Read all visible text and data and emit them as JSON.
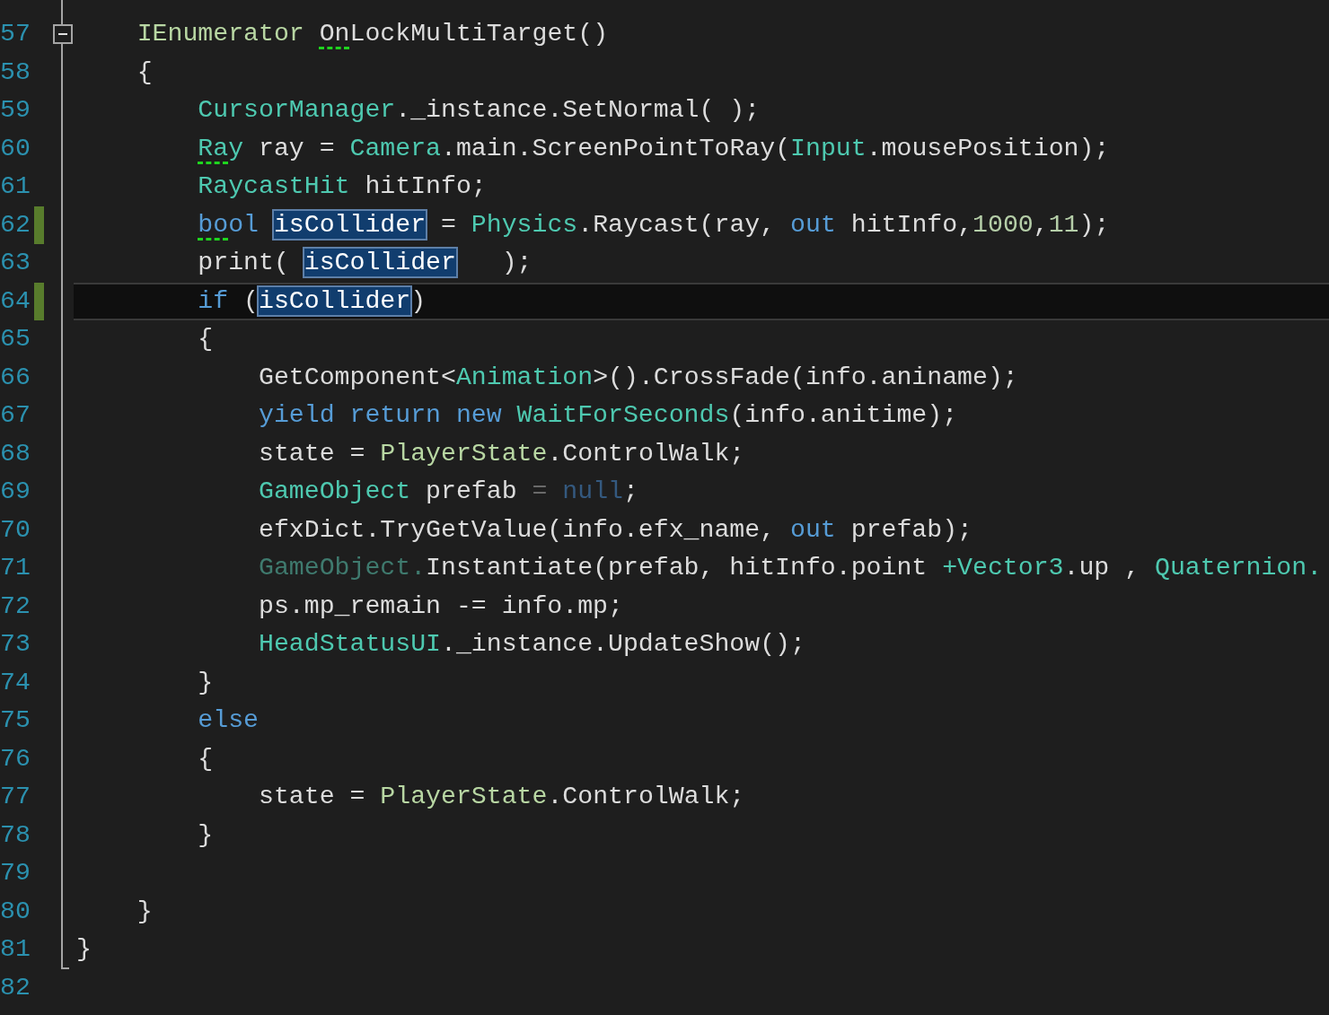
{
  "lines": [
    {
      "number": "57",
      "changed": false,
      "current": false,
      "fold_start": true,
      "fold_end": false,
      "tokens": [
        {
          "text": "    IEnumerator ",
          "kind": "interface"
        },
        {
          "text": "On",
          "kind": "plain",
          "squiggle": true
        },
        {
          "text": "LockMultiTarget()",
          "kind": "plain"
        }
      ]
    },
    {
      "number": "58",
      "changed": false,
      "current": false,
      "fold_start": false,
      "fold_end": false,
      "tokens": [
        {
          "text": "    {",
          "kind": "plain"
        }
      ]
    },
    {
      "number": "59",
      "changed": false,
      "current": false,
      "fold_start": false,
      "fold_end": false,
      "tokens": [
        {
          "text": "        CursorManager",
          "kind": "type"
        },
        {
          "text": "._instance.SetNormal( );",
          "kind": "plain"
        }
      ]
    },
    {
      "number": "60",
      "changed": false,
      "current": false,
      "fold_start": false,
      "fold_end": false,
      "tokens": [
        {
          "text": "        Ra",
          "kind": "type",
          "squiggle": true
        },
        {
          "text": "y",
          "kind": "type"
        },
        {
          "text": " ray = ",
          "kind": "plain"
        },
        {
          "text": "Camera",
          "kind": "type"
        },
        {
          "text": ".main.ScreenPointToRay(",
          "kind": "plain"
        },
        {
          "text": "Input",
          "kind": "type"
        },
        {
          "text": ".mousePosition);",
          "kind": "plain"
        }
      ]
    },
    {
      "number": "61",
      "changed": false,
      "current": false,
      "fold_start": false,
      "fold_end": false,
      "tokens": [
        {
          "text": "        RaycastHit",
          "kind": "type"
        },
        {
          "text": " hitInfo;",
          "kind": "plain"
        }
      ]
    },
    {
      "number": "62",
      "changed": true,
      "current": false,
      "fold_start": false,
      "fold_end": false,
      "tokens": [
        {
          "text": "        bo",
          "kind": "keyword",
          "squiggle": true
        },
        {
          "text": "ol ",
          "kind": "keyword"
        },
        {
          "text": "isCollider",
          "kind": "match"
        },
        {
          "text": " = ",
          "kind": "plain"
        },
        {
          "text": "Physics",
          "kind": "type"
        },
        {
          "text": ".Raycast(ray, ",
          "kind": "plain"
        },
        {
          "text": "out",
          "kind": "keyword"
        },
        {
          "text": " hitInfo,",
          "kind": "plain"
        },
        {
          "text": "1000",
          "kind": "number"
        },
        {
          "text": ",",
          "kind": "plain"
        },
        {
          "text": "11",
          "kind": "number"
        },
        {
          "text": ");",
          "kind": "plain"
        }
      ]
    },
    {
      "number": "63",
      "changed": false,
      "current": false,
      "fold_start": false,
      "fold_end": false,
      "tokens": [
        {
          "text": "        print( ",
          "kind": "plain"
        },
        {
          "text": "isCollider",
          "kind": "match"
        },
        {
          "text": "   );",
          "kind": "plain"
        }
      ]
    },
    {
      "number": "64",
      "changed": true,
      "current": true,
      "fold_start": false,
      "fold_end": false,
      "tokens": [
        {
          "text": "        if",
          "kind": "keyword"
        },
        {
          "text": " (",
          "kind": "plain"
        },
        {
          "text": "isCollider",
          "kind": "match"
        },
        {
          "text": ")",
          "kind": "plain"
        }
      ]
    },
    {
      "number": "65",
      "changed": false,
      "current": false,
      "fold_start": false,
      "fold_end": false,
      "tokens": [
        {
          "text": "        {",
          "kind": "plain"
        }
      ]
    },
    {
      "number": "66",
      "changed": false,
      "current": false,
      "fold_start": false,
      "fold_end": false,
      "tokens": [
        {
          "text": "            GetComponent<",
          "kind": "plain"
        },
        {
          "text": "Animation",
          "kind": "type"
        },
        {
          "text": ">().CrossFade(info.aniname);",
          "kind": "plain"
        }
      ]
    },
    {
      "number": "67",
      "changed": false,
      "current": false,
      "fold_start": false,
      "fold_end": false,
      "tokens": [
        {
          "text": "            yield return new ",
          "kind": "keyword"
        },
        {
          "text": "WaitForSeconds",
          "kind": "type"
        },
        {
          "text": "(info.anitime);",
          "kind": "plain"
        }
      ]
    },
    {
      "number": "68",
      "changed": false,
      "current": false,
      "fold_start": false,
      "fold_end": false,
      "tokens": [
        {
          "text": "            state = ",
          "kind": "plain"
        },
        {
          "text": "PlayerState",
          "kind": "interface"
        },
        {
          "text": ".ControlWalk;",
          "kind": "plain"
        }
      ]
    },
    {
      "number": "69",
      "changed": false,
      "current": false,
      "fold_start": false,
      "fold_end": false,
      "tokens": [
        {
          "text": "            GameObject",
          "kind": "type"
        },
        {
          "text": " prefab ",
          "kind": "plain"
        },
        {
          "text": "= ",
          "kind": "dim-operator"
        },
        {
          "text": "null",
          "kind": "dim-keyword"
        },
        {
          "text": ";",
          "kind": "plain"
        }
      ]
    },
    {
      "number": "70",
      "changed": false,
      "current": false,
      "fold_start": false,
      "fold_end": false,
      "tokens": [
        {
          "text": "            efxDict.TryGetValue(info.efx_name, ",
          "kind": "plain"
        },
        {
          "text": "out",
          "kind": "keyword"
        },
        {
          "text": " prefab);",
          "kind": "plain"
        }
      ]
    },
    {
      "number": "71",
      "changed": false,
      "current": false,
      "fold_start": false,
      "fold_end": false,
      "tokens": [
        {
          "text": "            GameObject.",
          "kind": "dim-type"
        },
        {
          "text": "Instantiate(prefab, hitInfo.point ",
          "kind": "plain"
        },
        {
          "text": "+Vector3",
          "kind": "type"
        },
        {
          "text": ".up , ",
          "kind": "plain"
        },
        {
          "text": "Quaternion.",
          "kind": "type"
        }
      ]
    },
    {
      "number": "72",
      "changed": false,
      "current": false,
      "fold_start": false,
      "fold_end": false,
      "tokens": [
        {
          "text": "            ps.mp_remain -= info.mp;",
          "kind": "plain"
        }
      ]
    },
    {
      "number": "73",
      "changed": false,
      "current": false,
      "fold_start": false,
      "fold_end": false,
      "tokens": [
        {
          "text": "            HeadStatusUI",
          "kind": "type"
        },
        {
          "text": "._instance.UpdateShow();",
          "kind": "plain"
        }
      ]
    },
    {
      "number": "74",
      "changed": false,
      "current": false,
      "fold_start": false,
      "fold_end": false,
      "tokens": [
        {
          "text": "        }",
          "kind": "plain"
        }
      ]
    },
    {
      "number": "75",
      "changed": false,
      "current": false,
      "fold_start": false,
      "fold_end": false,
      "tokens": [
        {
          "text": "        else",
          "kind": "keyword"
        }
      ]
    },
    {
      "number": "76",
      "changed": false,
      "current": false,
      "fold_start": false,
      "fold_end": false,
      "tokens": [
        {
          "text": "        {",
          "kind": "plain"
        }
      ]
    },
    {
      "number": "77",
      "changed": false,
      "current": false,
      "fold_start": false,
      "fold_end": false,
      "tokens": [
        {
          "text": "            state = ",
          "kind": "plain"
        },
        {
          "text": "PlayerState",
          "kind": "interface"
        },
        {
          "text": ".ControlWalk;",
          "kind": "plain"
        }
      ]
    },
    {
      "number": "78",
      "changed": false,
      "current": false,
      "fold_start": false,
      "fold_end": false,
      "tokens": [
        {
          "text": "        }",
          "kind": "plain"
        }
      ]
    },
    {
      "number": "79",
      "changed": false,
      "current": false,
      "fold_start": false,
      "fold_end": false
    },
    {
      "number": "80",
      "changed": false,
      "current": false,
      "fold_start": false,
      "fold_end": false,
      "tokens": [
        {
          "text": "    }",
          "kind": "plain"
        }
      ]
    },
    {
      "number": "81",
      "changed": false,
      "current": false,
      "fold_start": false,
      "fold_end": true,
      "tokens": [
        {
          "text": "}",
          "kind": "plain"
        }
      ]
    },
    {
      "number": "82",
      "changed": false,
      "current": false,
      "fold_start": false,
      "fold_end": false
    }
  ]
}
